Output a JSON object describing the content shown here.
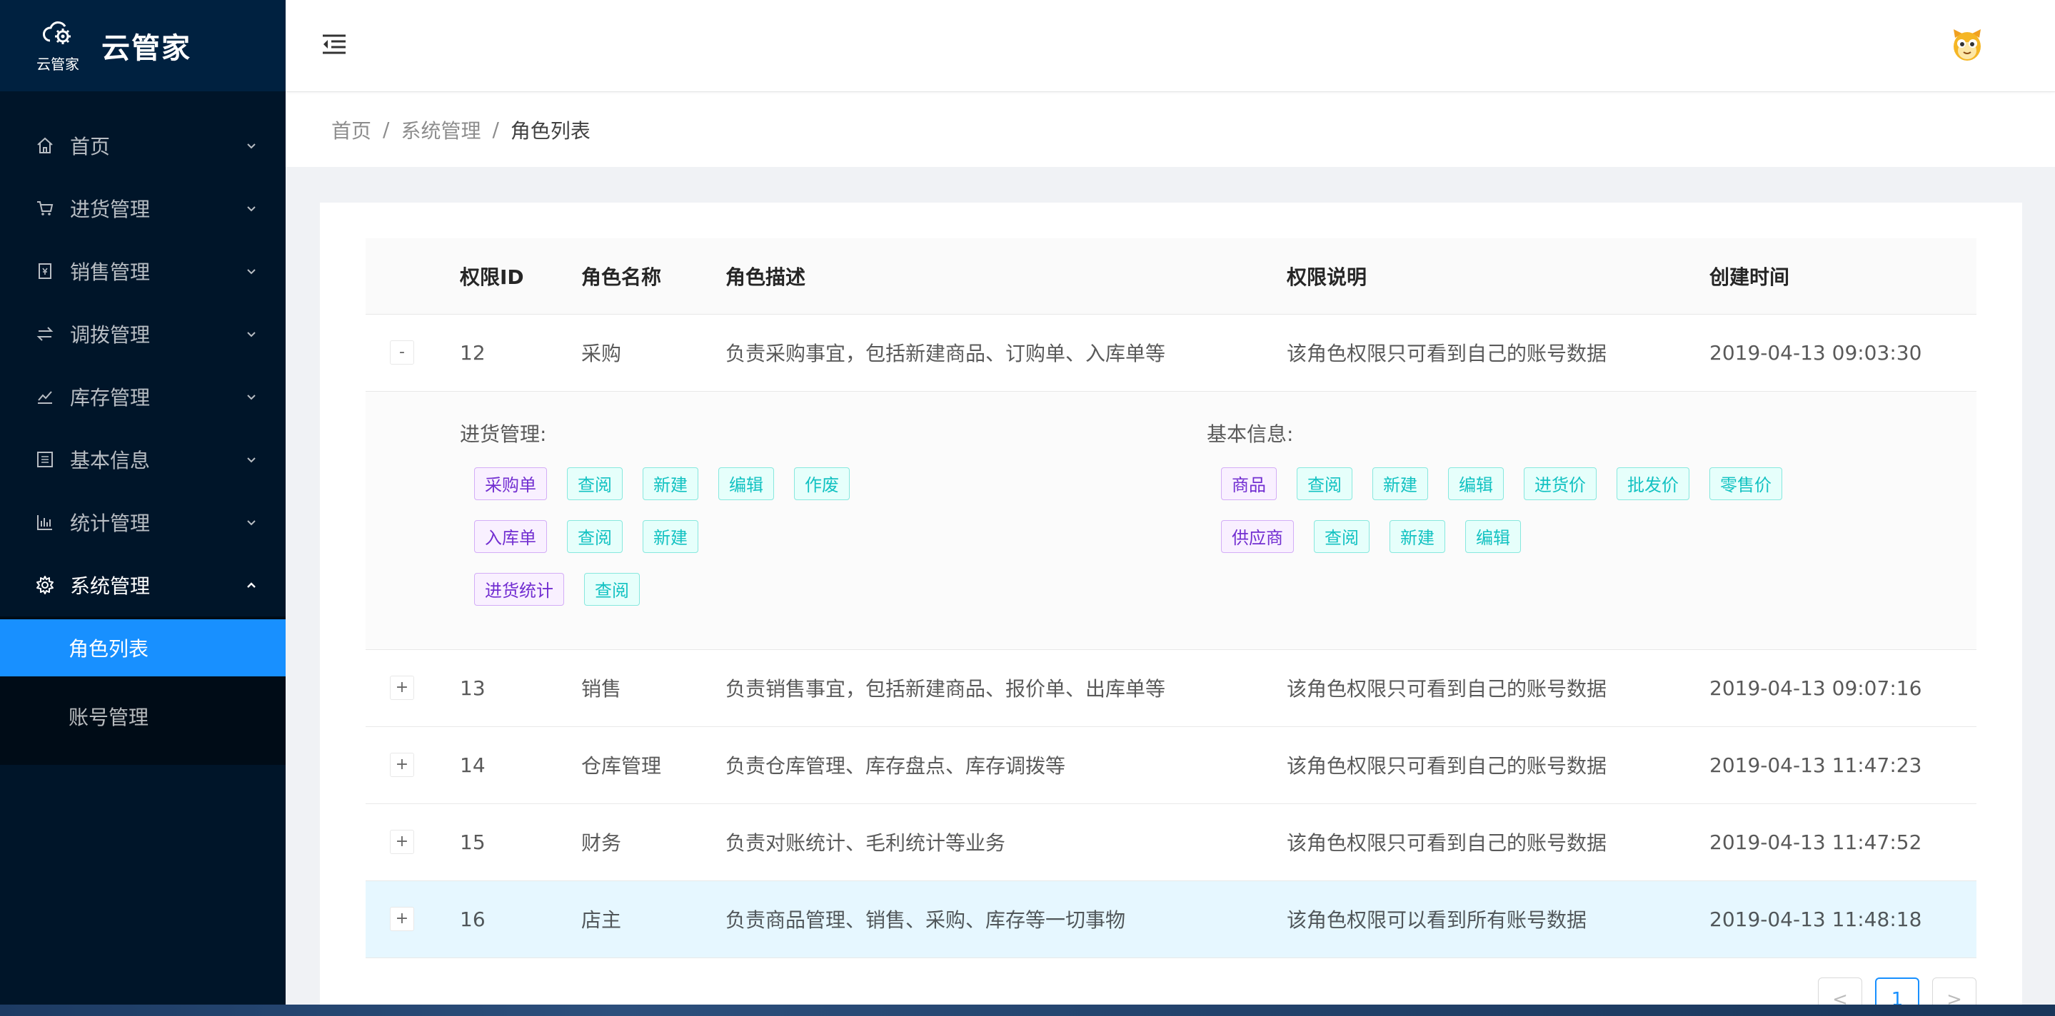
{
  "app": {
    "logo_small": "云管家",
    "title": "云管家"
  },
  "sidebar": {
    "items": [
      {
        "label": "首页",
        "icon": "home-icon",
        "open": false
      },
      {
        "label": "进货管理",
        "icon": "cart-icon",
        "open": false
      },
      {
        "label": "销售管理",
        "icon": "receipt-icon",
        "open": false
      },
      {
        "label": "调拨管理",
        "icon": "swap-icon",
        "open": false
      },
      {
        "label": "库存管理",
        "icon": "line-chart-icon",
        "open": false
      },
      {
        "label": "基本信息",
        "icon": "profile-icon",
        "open": false
      },
      {
        "label": "统计管理",
        "icon": "bar-chart-icon",
        "open": false
      },
      {
        "label": "系统管理",
        "icon": "gear-icon",
        "open": true
      }
    ],
    "sub_items": [
      {
        "label": "角色列表",
        "active": true
      },
      {
        "label": "账号管理",
        "active": false
      }
    ]
  },
  "breadcrumb": [
    "首页",
    "系统管理",
    "角色列表"
  ],
  "table": {
    "headers": [
      "权限ID",
      "角色名称",
      "角色描述",
      "权限说明",
      "创建时间"
    ],
    "rows": [
      {
        "expand": "-",
        "id": "12",
        "name": "采购",
        "desc": "负责采购事宜，包括新建商品、订购单、入库单等",
        "perm": "该角色权限只可看到自己的账号数据",
        "time": "2019-04-13 09:03:30"
      },
      {
        "expand": "+",
        "id": "13",
        "name": "销售",
        "desc": "负责销售事宜，包括新建商品、报价单、出库单等",
        "perm": "该角色权限只可看到自己的账号数据",
        "time": "2019-04-13 09:07:16"
      },
      {
        "expand": "+",
        "id": "14",
        "name": "仓库管理",
        "desc": "负责仓库管理、库存盘点、库存调拨等",
        "perm": "该角色权限只可看到自己的账号数据",
        "time": "2019-04-13 11:47:23"
      },
      {
        "expand": "+",
        "id": "15",
        "name": "财务",
        "desc": "负责对账统计、毛利统计等业务",
        "perm": "该角色权限只可看到自己的账号数据",
        "time": "2019-04-13 11:47:52"
      },
      {
        "expand": "+",
        "id": "16",
        "name": "店主",
        "desc": "负责商品管理、销售、采购、库存等一切事物",
        "perm": "该角色权限可以看到所有账号数据",
        "time": "2019-04-13 11:48:18"
      }
    ],
    "expanded": {
      "left_title": "进货管理:",
      "left_rows": [
        [
          "采购单",
          "查阅",
          "新建",
          "编辑",
          "作废"
        ],
        [
          "入库单",
          "查阅",
          "新建"
        ],
        [
          "进货统计",
          "查阅"
        ]
      ],
      "right_title": "基本信息:",
      "right_rows": [
        [
          "商品",
          "查阅",
          "新建",
          "编辑",
          "进货价",
          "批发价",
          "零售价"
        ],
        [
          "供应商",
          "查阅",
          "新建",
          "编辑"
        ]
      ]
    }
  },
  "pagination": {
    "prev": "<",
    "current": "1",
    "next": ">"
  },
  "colors": {
    "primary": "#1890ff",
    "sidebar": "#001529",
    "tag_purple": "#722ed1",
    "tag_cyan": "#13c2c2"
  }
}
